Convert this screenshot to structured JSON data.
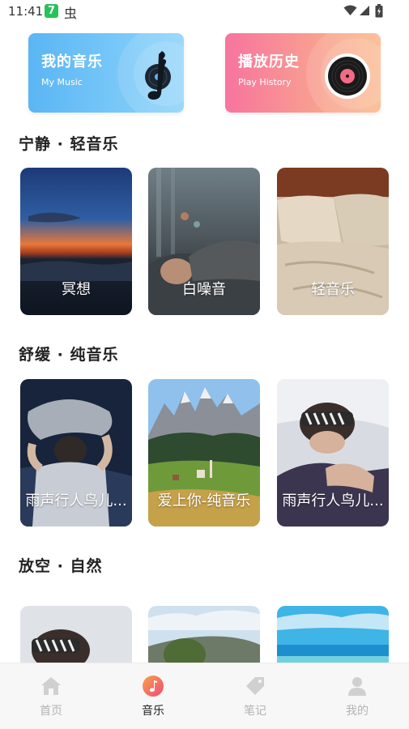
{
  "status_bar": {
    "time": "11:41",
    "badge": "7",
    "bug_glyph": "虫"
  },
  "top_cards": {
    "my_music": {
      "title": "我的音乐",
      "subtitle": "My Music",
      "icon": "music-note-icon"
    },
    "history": {
      "title": "播放历史",
      "subtitle": "Play History",
      "icon": "vinyl-record-icon"
    }
  },
  "sections": [
    {
      "title": "宁静 · 轻音乐",
      "tiles": [
        {
          "label": "冥想"
        },
        {
          "label": "白噪音"
        },
        {
          "label": "轻音乐"
        }
      ]
    },
    {
      "title": "舒缓 · 纯音乐",
      "tiles": [
        {
          "label": "雨声行人鸟儿..."
        },
        {
          "label": "爱上你-纯音乐"
        },
        {
          "label": "雨声行人鸟儿..."
        }
      ]
    },
    {
      "title": "放空 · 自然",
      "tiles": [
        {
          "label": ""
        },
        {
          "label": ""
        },
        {
          "label": ""
        }
      ]
    }
  ],
  "bottom_nav": {
    "items": [
      {
        "label": "首页",
        "icon": "home-icon",
        "active": false
      },
      {
        "label": "音乐",
        "icon": "music-icon",
        "active": true
      },
      {
        "label": "笔记",
        "icon": "note-tag-icon",
        "active": false
      },
      {
        "label": "我的",
        "icon": "profile-icon",
        "active": false
      }
    ]
  },
  "colors": {
    "active_nav": "#f2566f",
    "inactive_nav": "#d0d0d0",
    "music_card": "#5ab6f4",
    "history_card": "#f7749e"
  }
}
